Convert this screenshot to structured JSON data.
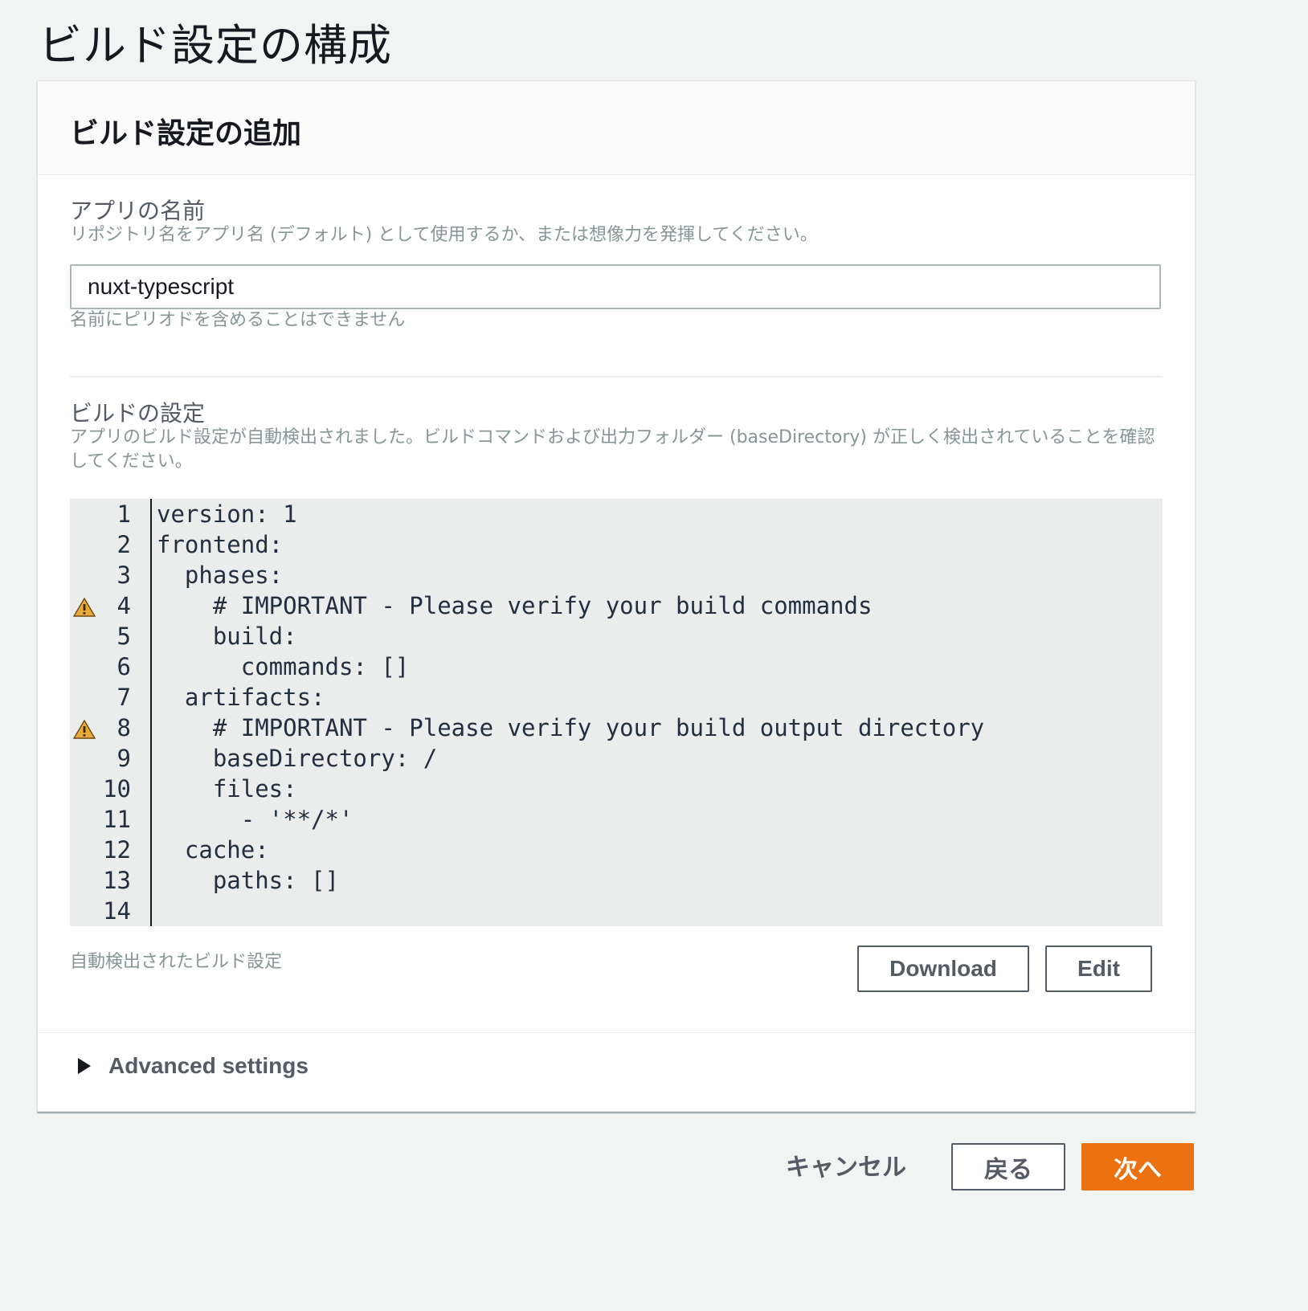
{
  "page": {
    "title": "ビルド設定の構成"
  },
  "card": {
    "header": "ビルド設定の追加",
    "app_name": {
      "label": "アプリの名前",
      "description": "リポジトリ名をアプリ名 (デフォルト) として使用するか、または想像力を発揮してください。",
      "value": "nuxt-typescript",
      "hint": "名前にピリオドを含めることはできません"
    },
    "build_settings": {
      "label": "ビルドの設定",
      "description": "アプリのビルド設定が自動検出されました。ビルドコマンドおよび出力フォルダー (baseDirectory) が正しく検出されていることを確認してください。",
      "lines": [
        {
          "no": "1",
          "code": "version: 1",
          "warning": false
        },
        {
          "no": "2",
          "code": "frontend:",
          "warning": false
        },
        {
          "no": "3",
          "code": "  phases:",
          "warning": false
        },
        {
          "no": "4",
          "code": "    # IMPORTANT - Please verify your build commands",
          "warning": true
        },
        {
          "no": "5",
          "code": "    build:",
          "warning": false
        },
        {
          "no": "6",
          "code": "      commands: []",
          "warning": false
        },
        {
          "no": "7",
          "code": "  artifacts:",
          "warning": false
        },
        {
          "no": "8",
          "code": "    # IMPORTANT - Please verify your build output directory",
          "warning": true
        },
        {
          "no": "9",
          "code": "    baseDirectory: /",
          "warning": false
        },
        {
          "no": "10",
          "code": "    files:",
          "warning": false
        },
        {
          "no": "11",
          "code": "      - '**/*'",
          "warning": false
        },
        {
          "no": "12",
          "code": "  cache:",
          "warning": false
        },
        {
          "no": "13",
          "code": "    paths: []",
          "warning": false
        },
        {
          "no": "14",
          "code": "",
          "warning": false
        }
      ],
      "caption": "自動検出されたビルド設定",
      "download_label": "Download",
      "edit_label": "Edit"
    },
    "advanced": {
      "label": "Advanced settings"
    }
  },
  "footer": {
    "cancel_label": "キャンセル",
    "back_label": "戻る",
    "next_label": "次へ"
  },
  "colors": {
    "primary": "#ec7211",
    "warning": "#e8a93a",
    "editor_bg": "#ebecec"
  },
  "icons": {
    "warning": "warning-triangle-icon",
    "expand": "caret-right-icon"
  }
}
